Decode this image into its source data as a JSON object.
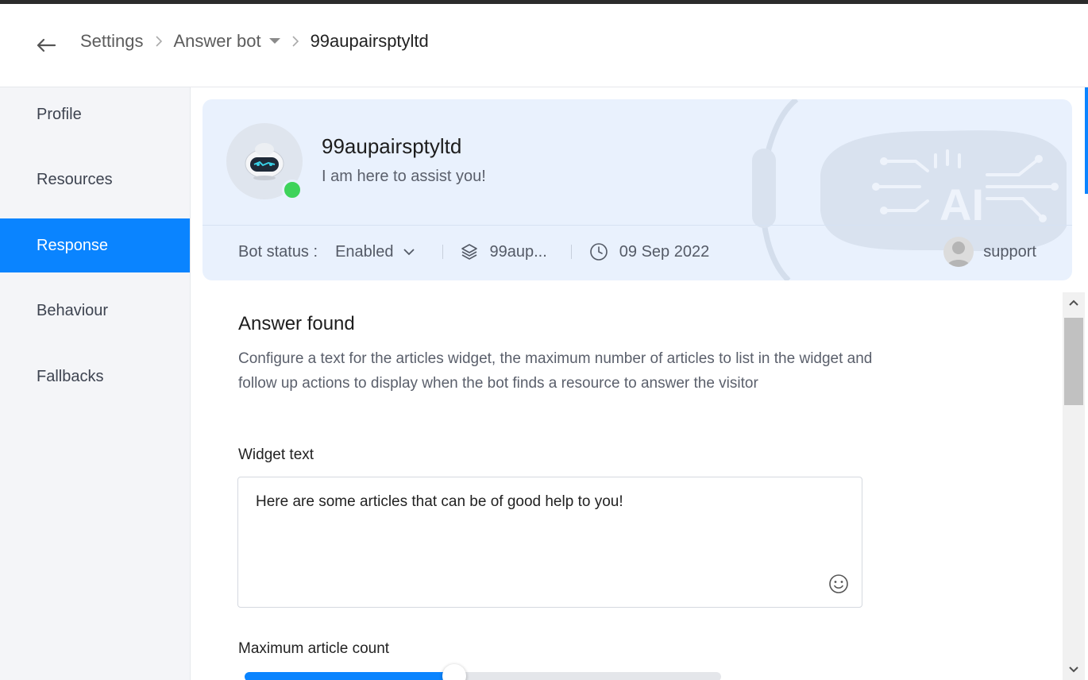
{
  "header": {
    "breadcrumbs": [
      "Settings",
      "Answer bot",
      "99aupairsptyltd"
    ]
  },
  "sidebar": {
    "items": [
      {
        "label": "Profile",
        "active": false
      },
      {
        "label": "Resources",
        "active": false
      },
      {
        "label": "Response",
        "active": true
      },
      {
        "label": "Behaviour",
        "active": false
      },
      {
        "label": "Fallbacks",
        "active": false
      }
    ]
  },
  "bot": {
    "name": "99aupairsptyltd",
    "tagline": "I am here to assist you!",
    "status_label": "Bot status :",
    "status_value": "Enabled",
    "department": "99aup...",
    "date": "09 Sep 2022",
    "owner": "support",
    "art_text": "AI",
    "online": true
  },
  "answer_found": {
    "title": "Answer found",
    "description": "Configure a text for the articles widget, the maximum number of articles to list in the widget and follow up actions to display when the bot finds a resource to answer the visitor",
    "widget_text_label": "Widget text",
    "widget_text_value": "Here are some articles that can be of good help to you!",
    "max_count_label": "Maximum article count",
    "max_count_fraction": 0.44
  },
  "colors": {
    "accent": "#0a84ff",
    "online": "#3ed35a",
    "card_bg": "#e9f1fd",
    "sidebar_bg": "#f4f5f8"
  }
}
